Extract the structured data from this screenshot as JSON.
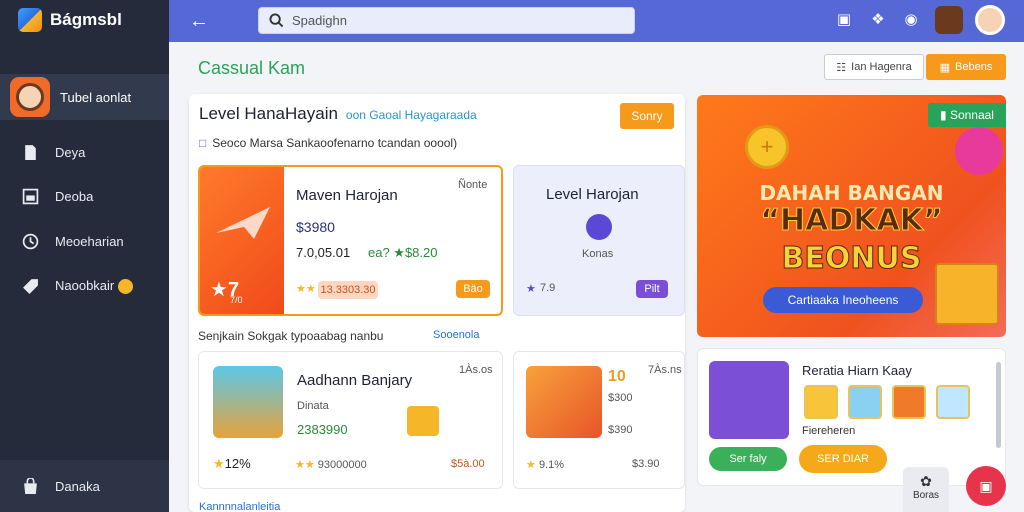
{
  "app": {
    "name": "Bágmsbl"
  },
  "sidebar": {
    "profile_name": "Tubel aonlat",
    "items": [
      {
        "label": "Deya",
        "icon": "document-icon"
      },
      {
        "label": "Deoba",
        "icon": "window-icon"
      },
      {
        "label": "Meoeharian",
        "icon": "clock-icon"
      },
      {
        "label": "Naoobkair",
        "icon": "tag-icon"
      }
    ],
    "bottom_label": "Danaka"
  },
  "topbar": {
    "search_placeholder": "Spadighn"
  },
  "page": {
    "title": "Cassual Kam",
    "outline_button": "Ian Hagenra",
    "orange_button": "Bebens"
  },
  "panel": {
    "title": "Level HanaHayain",
    "title_sub": "oon  Gaoal Hayagaraada",
    "button": "Sonry",
    "desc": "Seoco Marsa Sankaoofenarno tcandan ooool)",
    "card_a": {
      "title": "Maven Harojan",
      "corner": "Ñonte",
      "value": "$3980",
      "date": "7.0,05.01",
      "stat": "ea?  ★$8.20",
      "badge_rating": "7",
      "badge_sub": "7/0",
      "chip": "13.3303.30",
      "button": "Bäo"
    },
    "card_b": {
      "title": "Level Harojan",
      "sub": "Konas",
      "rating": "7.9",
      "button": "Pilt"
    },
    "section_label": "Senjkain Sokgak typoaabag nanbu",
    "section_link": "Sooenola",
    "card_c": {
      "title": "Aadhann Banjary",
      "corner": "1Às.os",
      "sub": "Dinata",
      "value": "2383990",
      "rating": "12%",
      "stat": "93000000",
      "price": "$5à.00"
    },
    "card_d": {
      "num": "10",
      "corner": "7Às.ns",
      "sub": "$300",
      "extra": "$390",
      "rating": "9.1%",
      "price": "$3.90"
    },
    "footer_link": "Kannnnalanleitia"
  },
  "banner": {
    "tag": "Sonnaal",
    "line1": "DAHAH BANGAN",
    "line2": "“HADKAK”",
    "line3": "BEONUS",
    "pill": "Cartiaaka  Ineoheens"
  },
  "rewards": {
    "title": "Reratia Hiarn Kaay",
    "sub": "Fiereheren",
    "green_button": "Ser faly",
    "amber_button": "SER DIAR"
  },
  "float_tool_label": "Boras",
  "colors": {
    "sidebar": "#252b3b",
    "topbar": "#5668d6",
    "accent_orange": "#f59a1a",
    "accent_green": "#2aa35a",
    "fab": "#e8344a"
  }
}
